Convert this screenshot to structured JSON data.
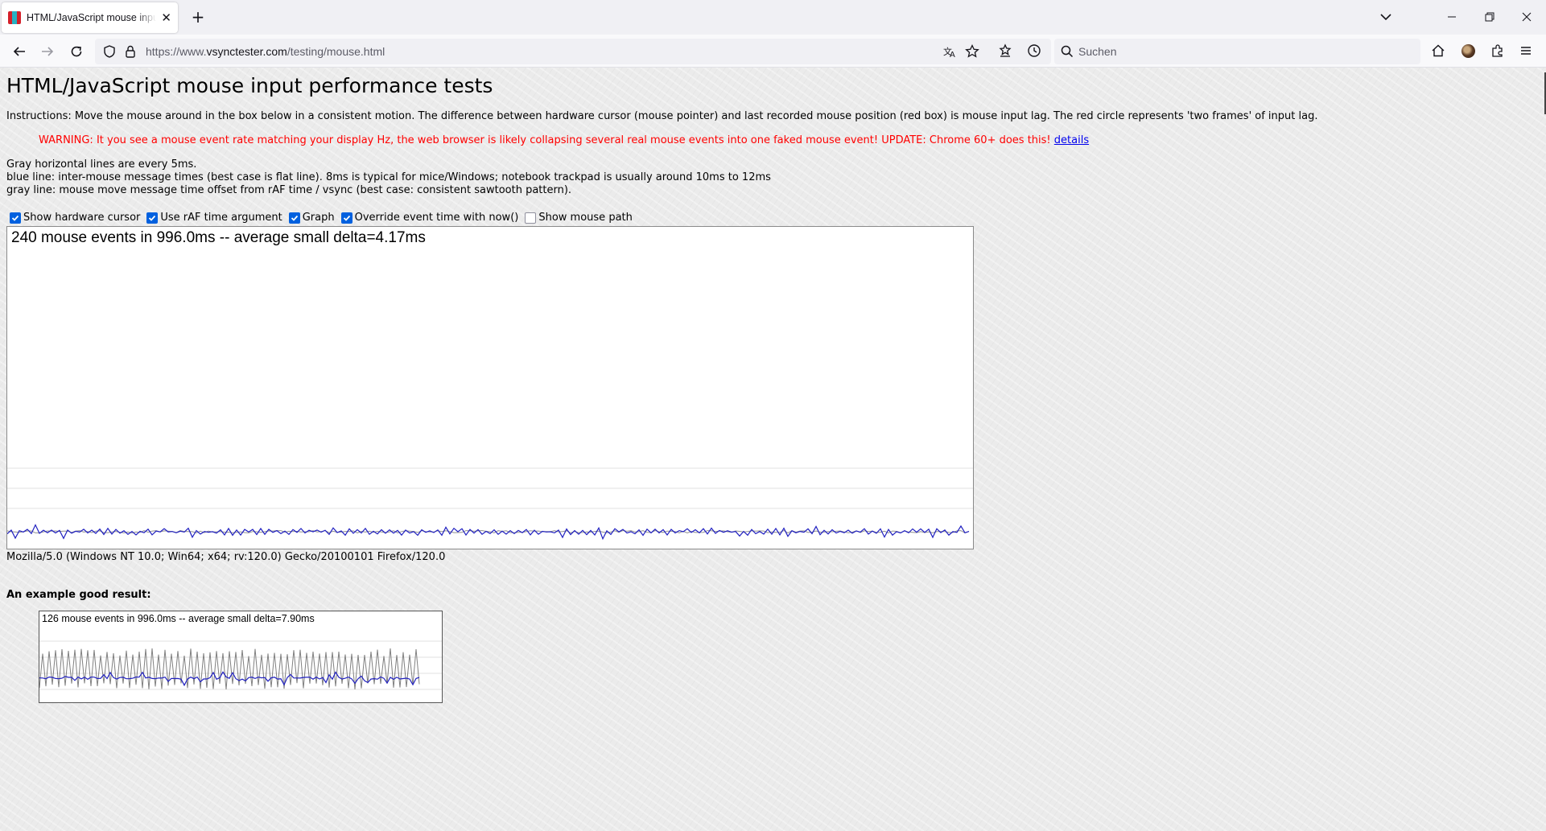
{
  "browser": {
    "tab": {
      "title": "HTML/JavaScript mouse input performance tests"
    },
    "url": {
      "prefix": "https://www.",
      "host": "vsynctester.com",
      "path": "/testing/mouse.html"
    },
    "search": {
      "placeholder": "Suchen"
    }
  },
  "page": {
    "title": "HTML/JavaScript mouse input performance tests",
    "instructions": "Instructions: Move the mouse around in the box below in a consistent motion. The difference between hardware cursor (mouse pointer) and last recorded mouse position (red box) is mouse input lag. The red circle represents 'two frames' of input lag.",
    "warning": {
      "text": "WARNING: It you see a mouse event rate matching your display Hz, the web browser is likely collapsing several real mouse events into one faked mouse event! UPDATE: Chrome 60+ does this!",
      "link": "details"
    },
    "legend": [
      "Gray horizontal lines are every 5ms.",
      "blue line: inter-mouse message times (best case is flat line). 8ms is typical for mice/Windows; notebook trackpad is usually around 10ms to 12ms",
      "gray line: mouse move message time offset from rAF time / vsync (best case: consistent sawtooth pattern)."
    ],
    "options": [
      {
        "label": "Show hardware cursor",
        "checked": true
      },
      {
        "label": "Use rAF time argument",
        "checked": true
      },
      {
        "label": "Graph",
        "checked": true
      },
      {
        "label": "Override event time with now()",
        "checked": true
      },
      {
        "label": "Show mouse path",
        "checked": false
      }
    ],
    "test_status": "240 mouse events in 996.0ms -- average small delta=4.17ms",
    "user_agent": "Mozilla/5.0 (Windows NT 10.0; Win64; x64; rv:120.0) Gecko/20100101 Firefox/120.0",
    "example_label": "An example good result:",
    "example_status": "126 mouse events in 996.0ms -- average small delta=7.90ms"
  },
  "colors": {
    "blue_line": "#2020c0",
    "gray_line": "#909090",
    "warning": "#ff0000",
    "link": "#0000ee",
    "checkbox": "#0060df"
  }
}
